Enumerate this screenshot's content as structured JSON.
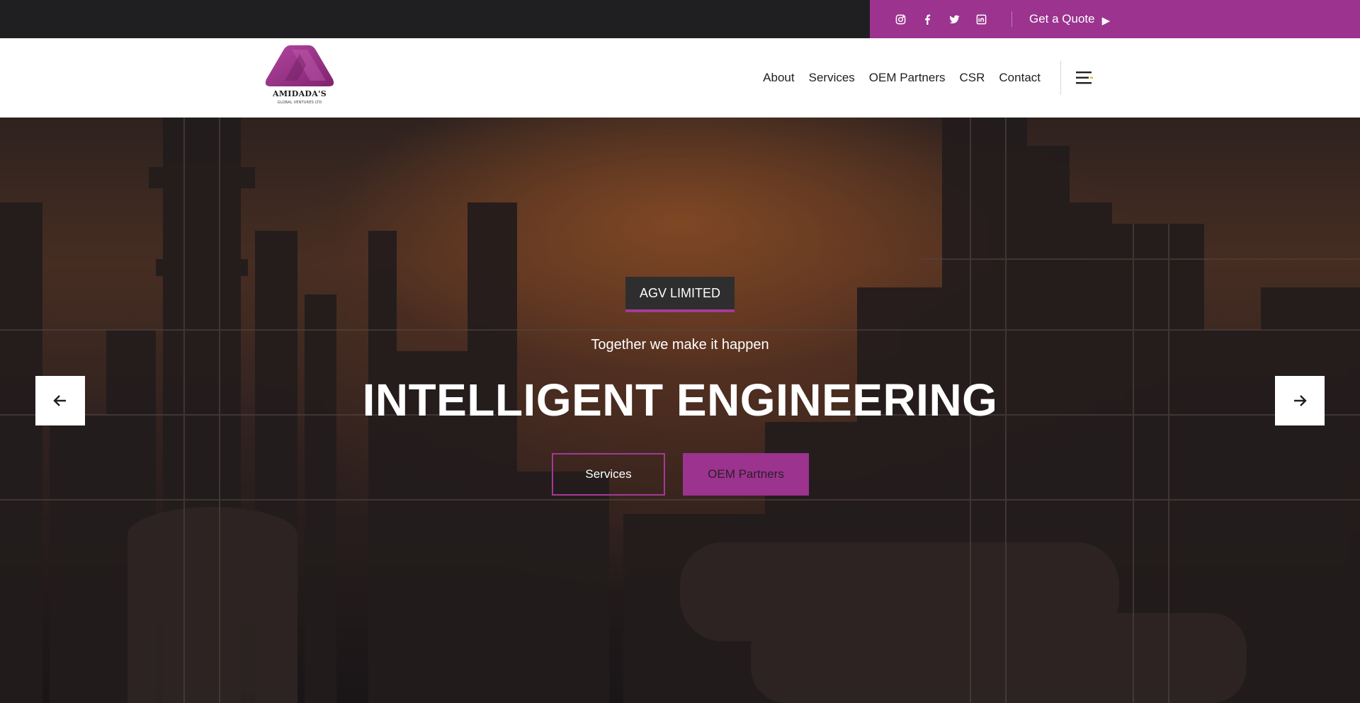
{
  "topbar": {
    "social": [
      {
        "name": "instagram-icon"
      },
      {
        "name": "facebook-icon"
      },
      {
        "name": "twitter-icon"
      },
      {
        "name": "linkedin-icon"
      }
    ],
    "quote_label": "Get a Quote",
    "quote_arrow": "▶"
  },
  "header": {
    "logo_title": "AMIDADA'S",
    "logo_subtitle": "GLOBAL VENTURES LTD",
    "nav": [
      "About",
      "Services",
      "OEM Partners",
      "CSR",
      "Contact"
    ]
  },
  "hero": {
    "tag": "AGV LIMITED",
    "tagline": "Together we make it happen",
    "headline": "INTELLIGENT ENGINEERING",
    "primary_button": "Services",
    "secondary_button": "OEM Partners"
  },
  "colors": {
    "accent": "#9b338f",
    "topbar_bg": "#1f1f21",
    "header_bg": "#ffffff"
  }
}
